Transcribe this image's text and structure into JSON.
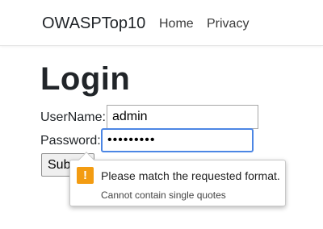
{
  "navbar": {
    "brand": "OWASPTop10",
    "links": [
      {
        "label": "Home"
      },
      {
        "label": "Privacy"
      }
    ]
  },
  "page": {
    "heading": "Login"
  },
  "form": {
    "username_label": "UserName:",
    "username_value": "admin",
    "password_label": "Password:",
    "password_value": "•••••••••",
    "submit_label": "Submit"
  },
  "validation_tooltip": {
    "icon": "warning-icon",
    "title": "Please match the requested format.",
    "detail": "Cannot contain single quotes",
    "accent_color": "#f39c12"
  }
}
